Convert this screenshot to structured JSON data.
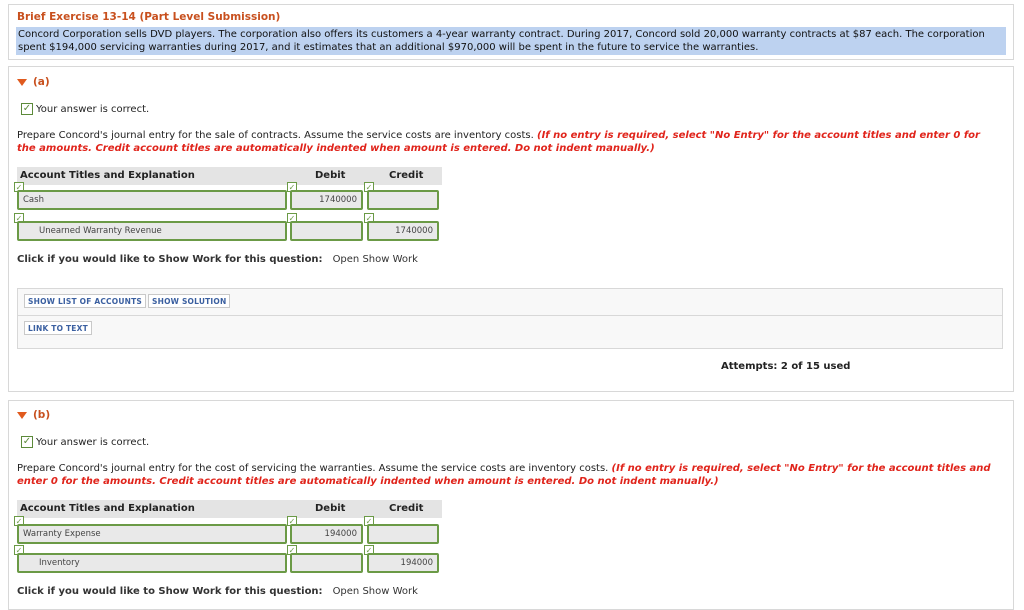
{
  "exercise": {
    "title": "Brief Exercise 13-14 (Part Level Submission)",
    "description": "Concord Corporation sells DVD players. The corporation also offers its customers a 4-year warranty contract. During 2017, Concord sold 20,000 warranty contracts at $87 each. The corporation spent $194,000 servicing warranties during 2017, and it estimates that an additional $970,000 will be spent in the future to service the warranties."
  },
  "part_a": {
    "label": "(a)",
    "correct_text": "Your answer is correct.",
    "prompt": "Prepare Concord's journal entry for the sale of contracts. Assume the service costs are inventory costs.",
    "instruction": "(If no entry is required, select \"No Entry\" for the account titles and enter 0 for the amounts. Credit account titles are automatically indented when amount is entered. Do not indent manually.)",
    "table_headers": {
      "account": "Account Titles and Explanation",
      "debit": "Debit",
      "credit": "Credit"
    },
    "rows": [
      {
        "account": "Cash",
        "debit": "1740000",
        "credit": ""
      },
      {
        "account": "Unearned Warranty Revenue",
        "debit": "",
        "credit": "1740000"
      }
    ],
    "show_work_label": "Click if you would like to Show Work for this question:",
    "show_work_link": "Open Show Work",
    "buttons": {
      "show_list": "SHOW LIST OF ACCOUNTS",
      "show_solution": "SHOW SOLUTION",
      "link_to_text": "LINK TO TEXT"
    },
    "attempts": "Attempts: 2 of 15 used"
  },
  "part_b": {
    "label": "(b)",
    "correct_text": "Your answer is correct.",
    "prompt": "Prepare Concord's journal entry for the cost of servicing the warranties. Assume the service costs are inventory costs.",
    "instruction": "(If no entry is required, select \"No Entry\" for the account titles and enter 0 for the amounts. Credit account titles are automatically indented when amount is entered. Do not indent manually.)",
    "table_headers": {
      "account": "Account Titles and Explanation",
      "debit": "Debit",
      "credit": "Credit"
    },
    "rows": [
      {
        "account": "Warranty Expense",
        "debit": "194000",
        "credit": ""
      },
      {
        "account": "Inventory",
        "debit": "",
        "credit": "194000"
      }
    ],
    "show_work_label": "Click if you would like to Show Work for this question:",
    "show_work_link": "Open Show Work"
  },
  "icons": {
    "check": "checkmark-icon",
    "toggle": "triangle-down-icon"
  },
  "colors": {
    "accent": "#c8501e",
    "instruction_red": "#e0241b",
    "field_border": "#6b9a46",
    "highlight": "#bdd2f0"
  }
}
